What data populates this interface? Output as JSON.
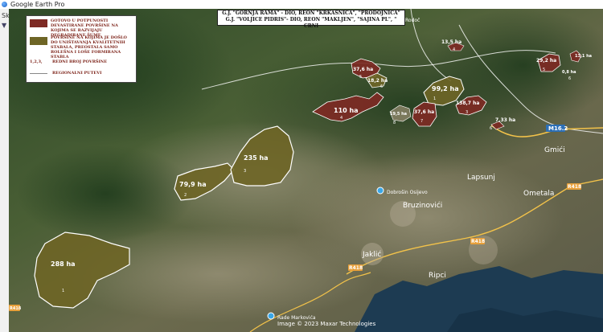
{
  "app": {
    "title": "Google Earth Pro",
    "toolbar_label": "Skrite"
  },
  "header": {
    "line1": "G.J. \"GORNJA RAMA\" - DIO, REON \"KRKAŠNICA\", \"PRODOJNICA\"",
    "line2": "G.J. \"VOLJICE PIDRIS\"- DIO, REON \"MAKLJEN\", \"SAJINA PL\", \" CRNI"
  },
  "legend": {
    "item1_text": "GOTOVO U POTPUNOSTI DEVASTIRANE POVRŠINE NA KOJIMA SE RAZVIJAJU DEGRADIRANE ŠUME",
    "item2_text": "POVRŠINE NA KOJIMA JE DOŠLO DO UNIŠTAVANJA KVALITETNIH STABALA, PREOSTALA SAMO ROLEŠNA I LOŠE FORMIRANA STABLA",
    "numbers_prefix": "1,2,3,",
    "numbers_text": "REDNI BROJ POVRŠINE",
    "roads_text": "REGIONALNI PUTEVI",
    "color_devastated": "#7d2a24",
    "color_damaged": "#6e6526"
  },
  "areas": [
    {
      "label": "288 ha",
      "num": "1"
    },
    {
      "label": "79,9 ha",
      "num": "2"
    },
    {
      "label": "235 ha",
      "num": "3"
    },
    {
      "label": "110 ha",
      "num": "4"
    },
    {
      "label": "37,6 ha",
      "num": "5"
    },
    {
      "label": "18,2 ha",
      "num": "6"
    },
    {
      "label": "99,2 ha",
      "num": "1"
    },
    {
      "label": "19,5 ha",
      "num": "8"
    },
    {
      "label": "37,6 ha",
      "num": "7"
    },
    {
      "label": "138,7 ha",
      "num": "3"
    },
    {
      "label": "13,5 ha",
      "num": "4"
    },
    {
      "label": "7,33 ha",
      "num": "6"
    },
    {
      "label": "29,2 ha",
      "num": "5"
    },
    {
      "label": "0,8 ha",
      "num": "6"
    },
    {
      "label": "13,1 ha",
      "num": ""
    }
  ],
  "places": {
    "gmici": "Gmići",
    "lapsunj": "Lapsunj",
    "ometala": "Ometala",
    "bruzinovici": "Bruzinovići",
    "jaklic": "Jaklić",
    "ripci": "Ripci",
    "poi1": "Dobrošin Osijevo",
    "poi2": "Rade Markovića",
    "rodoc": "Rodoč"
  },
  "roads": {
    "m162": "M16.2",
    "r418_a": "R418",
    "r418_b": "R418",
    "r418_c": "R418",
    "r418_d": "R418"
  },
  "attribution": "Image © 2023 Maxar Technologies"
}
